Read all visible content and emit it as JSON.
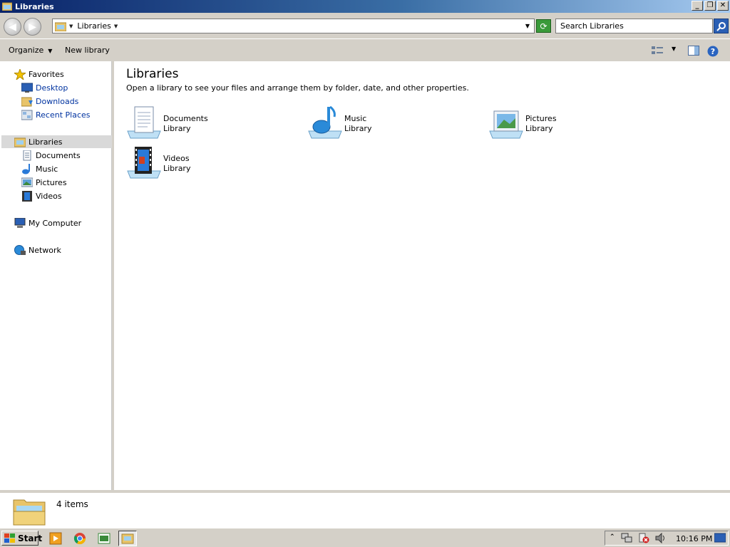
{
  "window": {
    "title": "Libraries"
  },
  "address": {
    "path_label": "Libraries",
    "search_placeholder": "Search Libraries"
  },
  "toolbar": {
    "organize_label": "Organize",
    "new_library_label": "New library"
  },
  "nav": {
    "favorites_label": "Favorites",
    "favorites_items": [
      "Desktop",
      "Downloads",
      "Recent Places"
    ],
    "libraries_label": "Libraries",
    "libraries_items": [
      "Documents",
      "Music",
      "Pictures",
      "Videos"
    ],
    "computer_label": "My Computer",
    "network_label": "Network"
  },
  "content": {
    "title": "Libraries",
    "subtitle": "Open a library to see your files and arrange them by folder, date, and other properties.",
    "libraries": [
      {
        "name": "Documents",
        "kind": "Library",
        "icon": "documents-library-icon"
      },
      {
        "name": "Music",
        "kind": "Library",
        "icon": "music-library-icon"
      },
      {
        "name": "Pictures",
        "kind": "Library",
        "icon": "pictures-library-icon"
      },
      {
        "name": "Videos",
        "kind": "Library",
        "icon": "videos-library-icon"
      }
    ]
  },
  "details": {
    "item_count": "4 items"
  },
  "taskbar": {
    "start_label": "Start",
    "clock": "10:16 PM"
  }
}
